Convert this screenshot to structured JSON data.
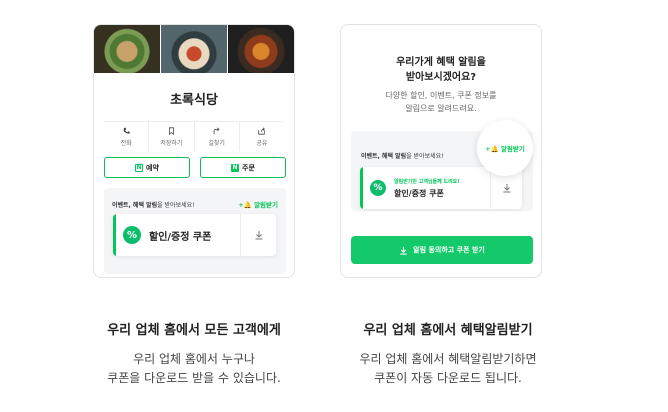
{
  "left_card": {
    "store_name": "초록식당",
    "actions": [
      {
        "label": "전화",
        "icon": "phone-icon"
      },
      {
        "label": "저장하기",
        "icon": "bookmark-icon"
      },
      {
        "label": "길찾기",
        "icon": "directions-icon"
      },
      {
        "label": "공유",
        "icon": "share-icon"
      }
    ],
    "reserve_label": "예약",
    "order_label": "주문",
    "benefit_prefix": "이벤트, 혜택 알림",
    "benefit_suffix": "을 받아보세요!",
    "notify_label": "+🔔 알림받기",
    "coupon_badge": "%",
    "coupon_title": "할인/증정 쿠폰"
  },
  "right_card": {
    "prompt_title_line1": "우리가게 혜택 알림을",
    "prompt_title_line2": "받아보시겠어요?",
    "prompt_sub_line1": "다양한 할인, 이벤트, 쿠폰 정보를",
    "prompt_sub_line2": "알림으로 알려드려요.",
    "benefit_prefix": "이벤트, 혜택 알림",
    "benefit_suffix": "을 받아보세요!",
    "notify_label": "+🔔 알림받기",
    "coupon_notice": "알림받기만 고객님들께 드려요!",
    "coupon_badge": "%",
    "coupon_title": "할인/증정 쿠폰",
    "cta_label": "알림 동의하고 쿠폰 받기"
  },
  "captions": {
    "left_title": "우리 업체 홈에서 모든 고객에게",
    "left_desc_line1": "우리 업체 홈에서 누구나",
    "left_desc_line2": "쿠폰을 다운로드 받을 수 있습니다.",
    "right_title": "우리 업체 홈에서 혜택알림받기",
    "right_desc_line1": "우리 업체 홈에서 혜택알림받기하면",
    "right_desc_line2": "쿠폰이 자동 다운로드 됩니다."
  },
  "colors": {
    "brand_green": "#03c75a",
    "cta_green": "#14c96a"
  }
}
